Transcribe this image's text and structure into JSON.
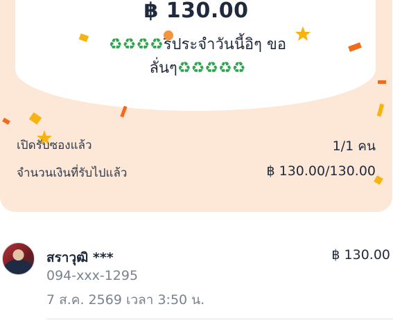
{
  "envelope": {
    "amount": "฿ 130.00",
    "message_line1": "♻♻♻♻รีประจำวันนี้อิๆ ขอ",
    "message_line2": "ลั่นๆ♻♻♻♻♻"
  },
  "stats": {
    "opened_label": "เปิดรับซองแล้ว",
    "opened_value": "1/1 คน",
    "received_label": "จำนวนเงินที่รับไปแล้ว",
    "received_value": "฿ 130.00/130.00"
  },
  "receiver": {
    "name": "สราวุฒิ ***",
    "amount": "฿ 130.00",
    "phone": "094-xxx-1295",
    "time": "7 ส.ค. 2569 เวลา 3:50 น."
  },
  "colors": {
    "card_bg": "#fde7d6",
    "recycle_green": "#2fa44f",
    "confetti_orange": "#f26a1b",
    "confetti_yellow": "#f5b40f"
  }
}
